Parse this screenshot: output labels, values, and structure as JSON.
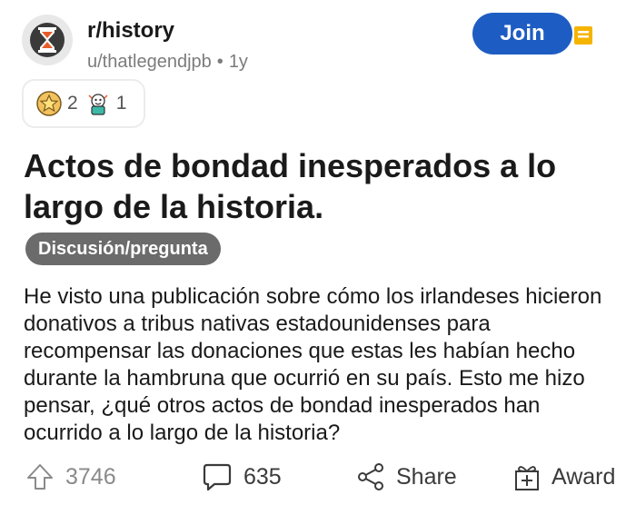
{
  "header": {
    "subreddit": "r/history",
    "username": "u/thatlegendjpb",
    "separator": "•",
    "age": "1y",
    "join_label": "Join"
  },
  "awards": [
    {
      "icon": "star-award-icon",
      "count": "2"
    },
    {
      "icon": "wholesome-award-icon",
      "count": "1"
    }
  ],
  "post": {
    "title": "Actos de bondad inesperados a lo largo de la historia.",
    "flair": "Discusión/pregunta",
    "body": "He visto una publicación sobre cómo los irlandeses hicieron donativos a tribus nativas estadounidenses para recompensar las donaciones que estas les habían hecho durante la hambruna que ocurrió en su país. Esto me hizo pensar, ¿qué otros actos de bondad inesperados han ocurrido a lo largo de la historia?"
  },
  "actions": {
    "votes": "3746",
    "comments": "635",
    "share_label": "Share",
    "award_label": "Award"
  },
  "colors": {
    "join_button": "#1d5dc3",
    "flair_bg": "#6b6b6b",
    "save_icon": "#f5b400",
    "avatar_icon": "#e85b2a"
  }
}
